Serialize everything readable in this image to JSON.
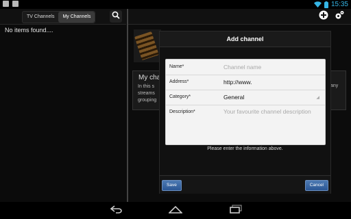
{
  "status": {
    "time": "15:35"
  },
  "tabs": [
    {
      "label": "TV Channels"
    },
    {
      "label": "My Channels"
    }
  ],
  "left": {
    "empty_text": "No items found...."
  },
  "info": {
    "title": "My cha",
    "line1": "In this s",
    "line2": "streams",
    "line3": "grouping",
    "right_text": "any"
  },
  "dialog": {
    "title": "Add channel",
    "fields": {
      "name": {
        "label": "Name*",
        "placeholder": "Channel name"
      },
      "address": {
        "label": "Address*",
        "value": "http://www."
      },
      "category": {
        "label": "Category*",
        "value": "General"
      },
      "description": {
        "label": "Description*",
        "placeholder": "Your favourite channel description"
      }
    },
    "hint": "Please enter the information above.",
    "save_label": "Save",
    "cancel_label": "Cancel"
  },
  "colors": {
    "status_blue": "#35b5e5",
    "button_blue": "#2a5694"
  }
}
